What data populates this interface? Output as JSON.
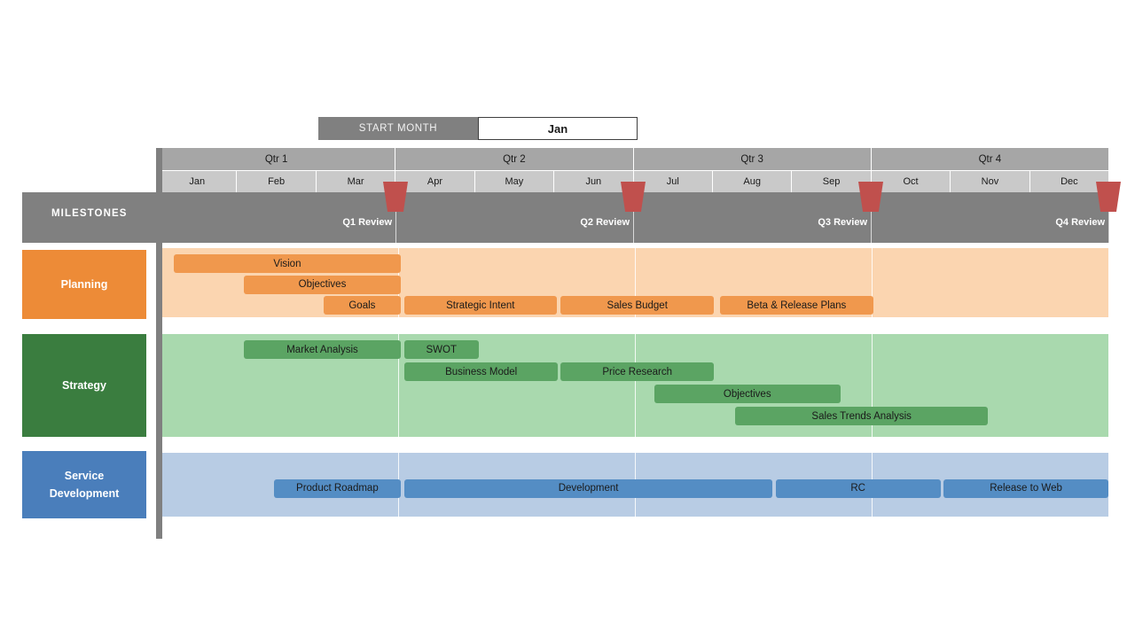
{
  "controls": {
    "start_month_label": "START MONTH",
    "start_month_value": "Jan"
  },
  "calendar": {
    "quarters": [
      "Qtr 1",
      "Qtr 2",
      "Qtr 3",
      "Qtr 4"
    ],
    "months": [
      "Jan",
      "Feb",
      "Mar",
      "Apr",
      "May",
      "Jun",
      "Jul",
      "Aug",
      "Sep",
      "Oct",
      "Nov",
      "Dec"
    ]
  },
  "milestones": {
    "title": "MILESTONES",
    "marker_color": "#c0504d",
    "items": [
      {
        "label": "Q1 Review",
        "month_index": 3
      },
      {
        "label": "Q2 Review",
        "month_index": 6
      },
      {
        "label": "Q3 Review",
        "month_index": 9
      },
      {
        "label": "Q4 Review",
        "month_index": 12
      }
    ]
  },
  "lanes": [
    {
      "name": "Planning",
      "label_lines": [
        "Planning"
      ],
      "label_color": "#ed8b37",
      "band_color": "#fbd5b0",
      "bar_color": "#f0984d",
      "rows": 3,
      "tasks": [
        {
          "label": "Vision",
          "row": 0,
          "start": 0.15,
          "end": 3.02
        },
        {
          "label": "Objectives",
          "row": 1,
          "start": 1.04,
          "end": 3.02
        },
        {
          "label": "Goals",
          "row": 2,
          "start": 2.05,
          "end": 3.02
        },
        {
          "label": "Strategic Intent",
          "row": 2,
          "start": 3.07,
          "end": 5.0
        },
        {
          "label": "Sales Budget",
          "row": 2,
          "start": 5.05,
          "end": 7.0
        },
        {
          "label": "Beta & Release Plans",
          "row": 2,
          "start": 7.07,
          "end": 9.02
        }
      ]
    },
    {
      "name": "Strategy",
      "label_lines": [
        "Strategy"
      ],
      "label_color": "#3a7d3f",
      "band_color": "#a9d9ae",
      "bar_color": "#5ba463",
      "rows": 4,
      "tasks": [
        {
          "label": "Market Analysis",
          "row": 0,
          "start": 1.04,
          "end": 3.02
        },
        {
          "label": "SWOT",
          "row": 0,
          "start": 3.07,
          "end": 4.01
        },
        {
          "label": "Business Model",
          "row": 1,
          "start": 3.07,
          "end": 5.02
        },
        {
          "label": "Price Research",
          "row": 1,
          "start": 5.05,
          "end": 7.0
        },
        {
          "label": "Objectives",
          "row": 2,
          "start": 6.24,
          "end": 8.6
        },
        {
          "label": "Sales Trends Analysis",
          "row": 3,
          "start": 7.27,
          "end": 10.47
        }
      ]
    },
    {
      "name": "Service Development",
      "label_lines": [
        "Service",
        "Development"
      ],
      "label_color": "#4a7ebb",
      "band_color": "#b8cce4",
      "bar_color": "#548dc4",
      "rows": 3,
      "tasks": [
        {
          "label": "Product Roadmap",
          "row": 1,
          "start": 1.42,
          "end": 3.02
        },
        {
          "label": "Development",
          "row": 1,
          "start": 3.07,
          "end": 7.74
        },
        {
          "label": "RC",
          "row": 1,
          "start": 7.78,
          "end": 9.87
        },
        {
          "label": "Release to Web",
          "row": 1,
          "start": 9.91,
          "end": 12.0
        }
      ]
    }
  ]
}
